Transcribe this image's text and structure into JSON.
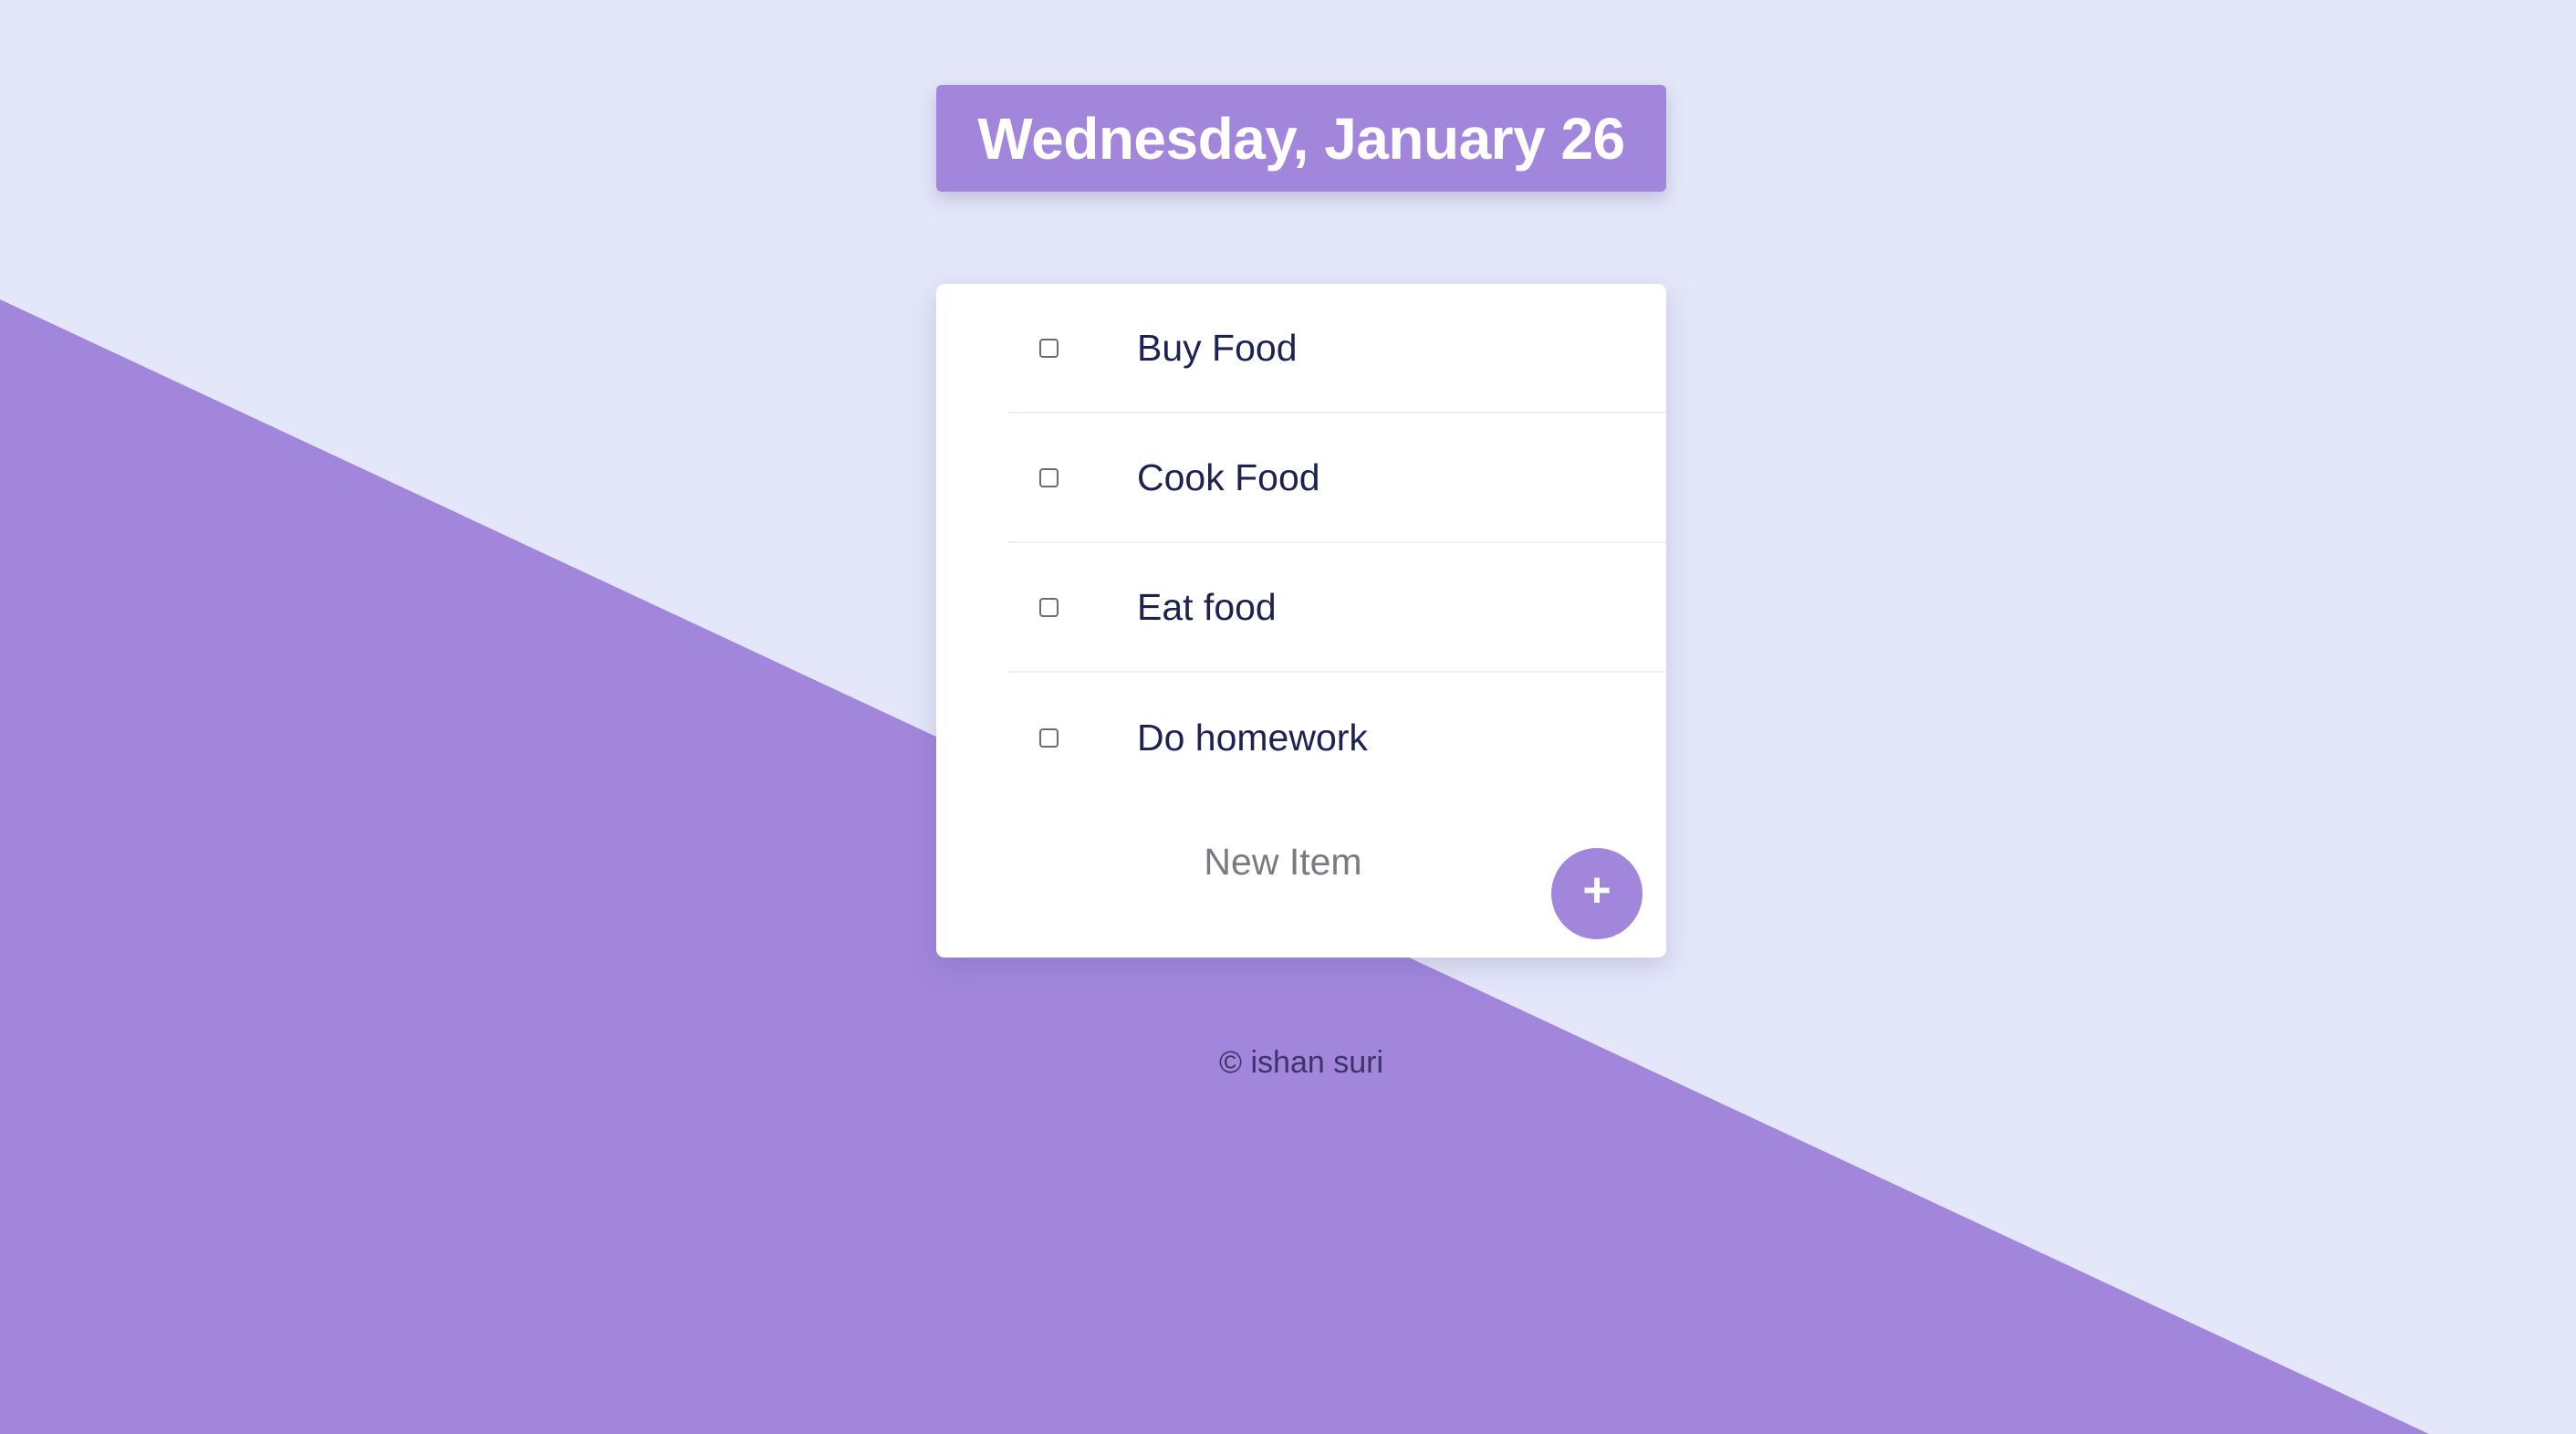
{
  "colors": {
    "background_light": "#E4E7F9",
    "accent_purple": "#A286DB",
    "card_bg": "#FFFFFF",
    "todo_text": "#1E2250",
    "footer_text": "#3E3366"
  },
  "header": {
    "date_title": "Wednesday, January 26"
  },
  "todos": {
    "items": [
      {
        "label": "Buy Food",
        "checked": false
      },
      {
        "label": "Cook Food",
        "checked": false
      },
      {
        "label": "Eat food",
        "checked": false
      },
      {
        "label": "Do homework",
        "checked": false
      }
    ]
  },
  "new_item": {
    "placeholder": "New Item",
    "add_button_label": "+",
    "add_icon": "plus-icon"
  },
  "footer": {
    "text": "© ishan suri"
  }
}
